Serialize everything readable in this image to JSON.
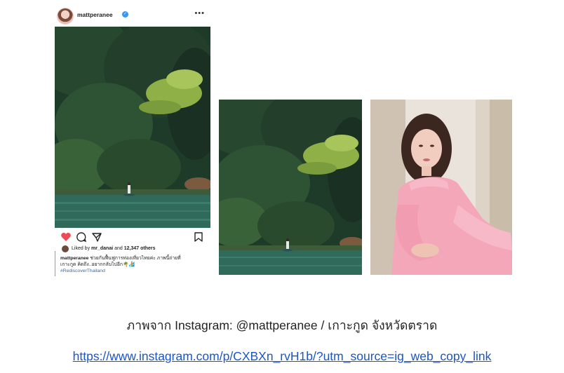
{
  "post": {
    "username": "mattperanee",
    "verified_icon": "verified-badge-icon",
    "more_icon": "more-horizontal-icon",
    "actions": {
      "like_icon": "heart-icon",
      "comment_icon": "comment-icon",
      "share_icon": "send-icon",
      "save_icon": "bookmark-icon",
      "like_color": "#ed4956"
    },
    "likes": {
      "prefix": "Liked by",
      "user": "mr_danai",
      "middle": "and",
      "count": "12,347 others"
    },
    "caption": {
      "user": "mattperanee",
      "line1": "ช่วยกันฟื้นฟูการท่องเที่ยวไทยค่ะ ภาพนี้ถ่ายที่",
      "line2": "เกาะกูด คิดถึง..อยากกลับไปอีก🌴🏄",
      "hashtag": "#RediscoverThailand"
    }
  },
  "credit_text": "ภาพจาก Instagram: @mattperanee / เกาะกูด จังหวัดตราด",
  "link_text": "https://www.instagram.com/p/CXBXn_rvH1b/?utm_source=ig_web_copy_link",
  "colors": {
    "link": "#1a56c9",
    "jungle_dark": "#1f3a2a",
    "water": "#2f6a5a",
    "dress_pink": "#f4a7b9"
  }
}
